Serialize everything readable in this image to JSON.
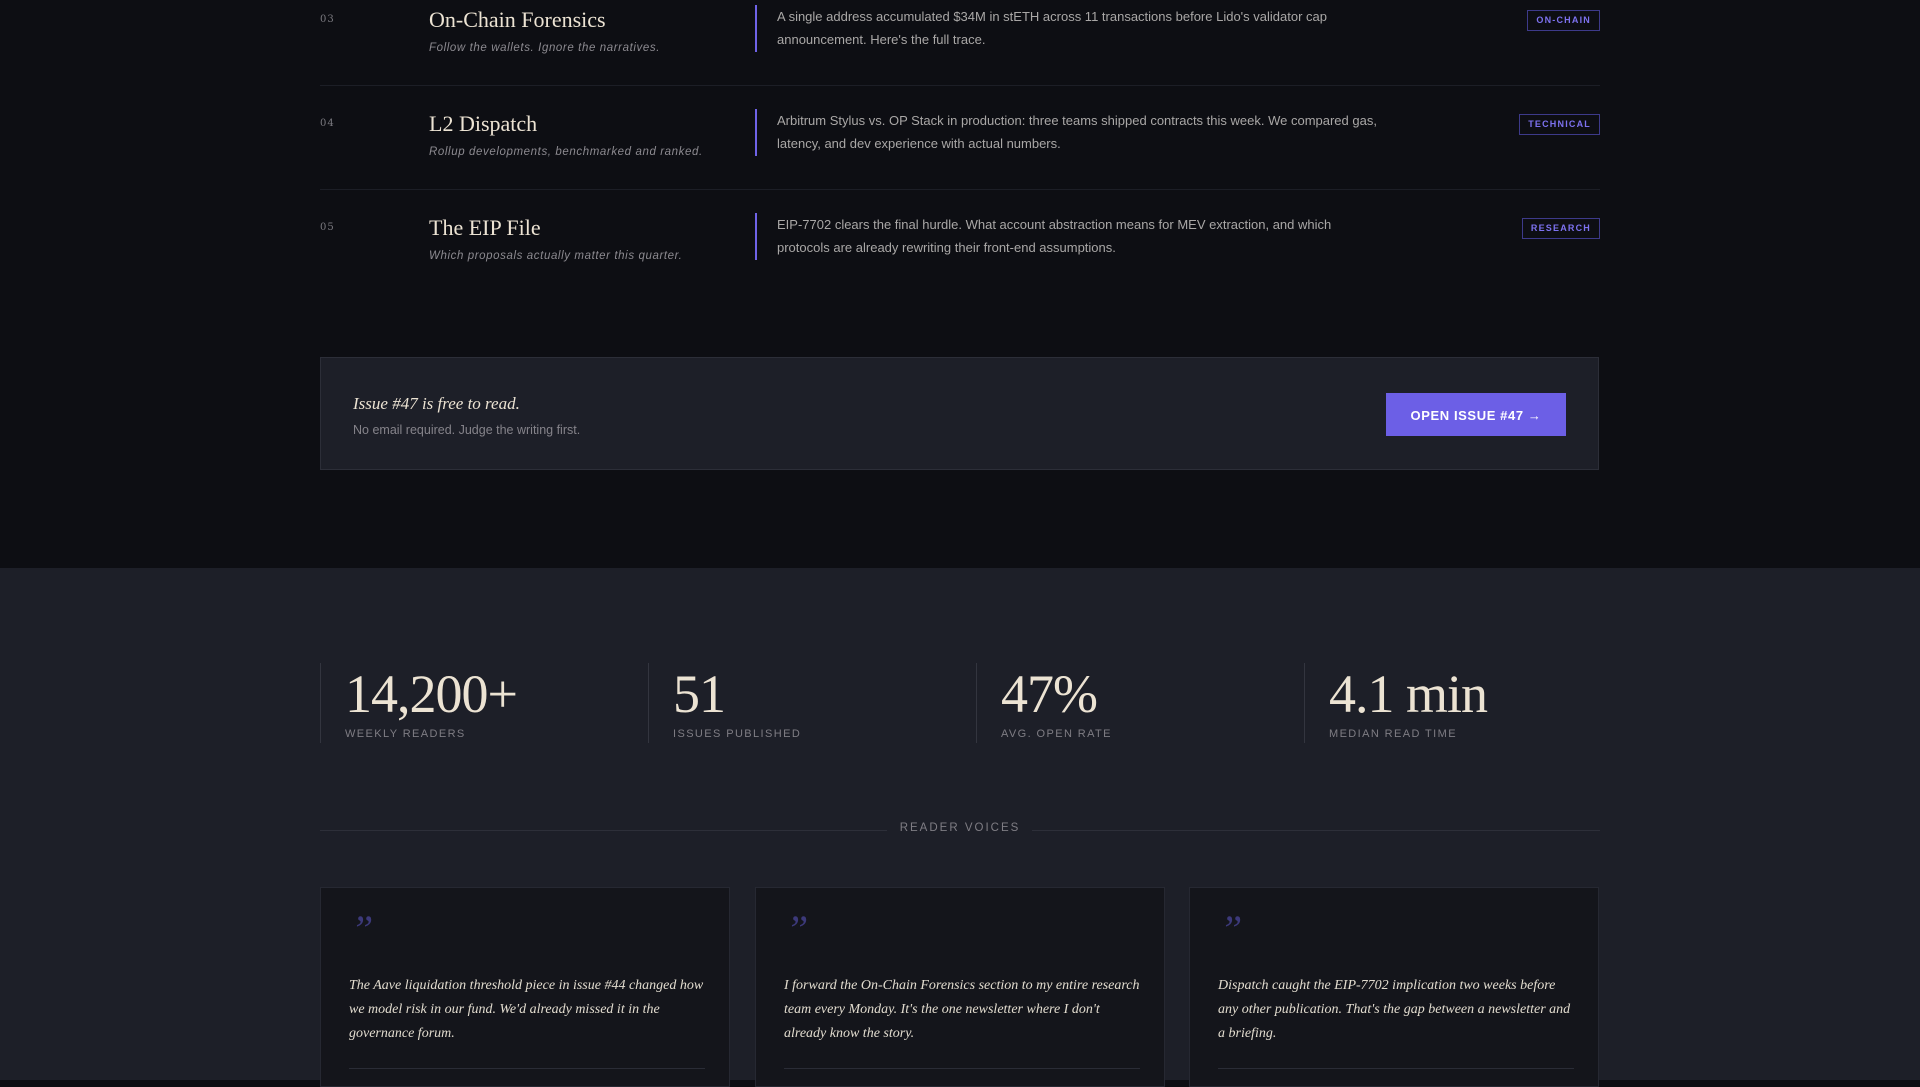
{
  "sections": [
    {
      "num": "03",
      "title": "On-Chain Forensics",
      "subtitle": "Follow the wallets. Ignore the narratives.",
      "description": "A single address accumulated $34M in stETH across 11 transactions before Lido's validator cap announcement. Here's the full trace.",
      "tag": "ON-CHAIN"
    },
    {
      "num": "04",
      "title": "L2 Dispatch",
      "subtitle": "Rollup developments, benchmarked and ranked.",
      "description": "Arbitrum Stylus vs. OP Stack in production: three teams shipped contracts this week. We compared gas, latency, and dev experience with actual numbers.",
      "tag": "TECHNICAL"
    },
    {
      "num": "05",
      "title": "The EIP File",
      "subtitle": "Which proposals actually matter this quarter.",
      "description": "EIP-7702 clears the final hurdle. What account abstraction means for MEV extraction, and which protocols are already rewriting their front-end assumptions.",
      "tag": "RESEARCH"
    }
  ],
  "banner": {
    "title": "Issue #47 is free to read.",
    "subtitle": "No email required. Judge the writing first.",
    "button": "OPEN ISSUE #47 →"
  },
  "stats": [
    {
      "value": "14,200+",
      "label": "WEEKLY READERS"
    },
    {
      "value": "51",
      "label": "ISSUES PUBLISHED"
    },
    {
      "value": "47%",
      "label": "AVG. OPEN RATE"
    },
    {
      "value": "4.1 min",
      "label": "MEDIAN READ TIME"
    }
  ],
  "voices": {
    "heading": "READER VOICES",
    "quote_mark": "”",
    "quotes": [
      "The Aave liquidation threshold piece in issue #44 changed how we model risk in our fund. We'd already missed it in the governance forum.",
      "I forward the On-Chain Forensics section to my entire research team every Monday. It's the one newsletter where I don't already know the story.",
      "Dispatch caught the EIP-7702 implication two weeks before any other publication. That's the gap between a newsletter and a briefing."
    ]
  },
  "colors": {
    "accent": "#6c5fe6",
    "background_dark": "#0d0e13",
    "background_panel": "#1d1f28",
    "text_cream": "#ece3d3"
  }
}
